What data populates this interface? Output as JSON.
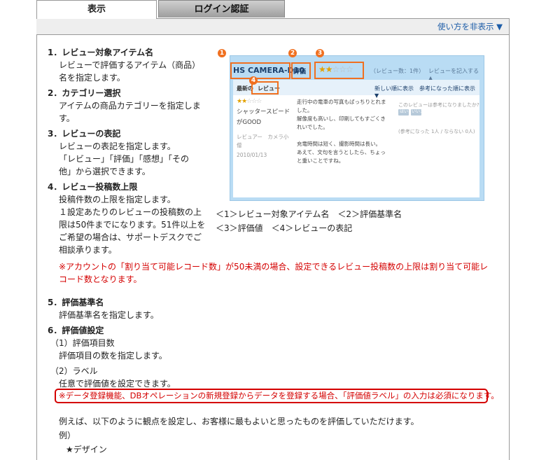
{
  "tabs": [
    {
      "label": "表示"
    },
    {
      "label": "ログイン認証"
    }
  ],
  "howto_toggle": "使い方を非表示 ▼",
  "sections": {
    "s1": {
      "heading": "1．レビュー対象アイテム名",
      "l1": "レビューで評価するアイテム（商品）",
      "l2": "名を指定します。"
    },
    "s2": {
      "heading": "2．カテゴリー選択",
      "l1": "アイテムの商品カテゴリーを指定しま",
      "l2": "す。"
    },
    "s3": {
      "heading": "3．レビューの表記",
      "l1": "レビューの表記を指定します。",
      "l2": "「レビュー」「評価」「感想」「その",
      "l3": "他」から選択できます。"
    },
    "s4": {
      "heading": "4．レビュー投稿数上限",
      "l1": "投稿件数の上限を指定します。",
      "l2": "１設定あたりのレビューの投稿数の上",
      "l3": "限は50件までになります。51件以上を",
      "l4": "ご希望の場合は、サポートデスクでご",
      "l5": "相談承ります。"
    },
    "note_red": "※アカウントの「割り当て可能レコード数」が50未満の場合、設定できるレビュー投稿数の上限は割り当て可能レコード数となります。",
    "s5": {
      "heading": "5．評価基準名",
      "l1": "評価基準名を指定します。"
    },
    "s6": {
      "heading": "6．評価値設定",
      "sub1": "（1）評価項目数",
      "sub1_text": "評価項目の数を指定します。",
      "sub2": "（2）ラベル",
      "sub2_text": "任意で評価値を設定できます。",
      "sub2_warning": "※データ登録機能、DBオペレーションの新規登録からデータを登録する場合、「評価値ラベル」の入力は必須になります。",
      "example_intro": "例えば、以下のように観点を設定し、お客様に最もよいと思ったものを評価していただけます。",
      "example_label": "例）",
      "example_item": "★デザイン"
    }
  },
  "preview": {
    "num1": "1",
    "num2": "2",
    "num3": "3",
    "num4": "4",
    "item_title": "HS CAMERA-D10",
    "eval_label": "評価",
    "stars_top": "★★☆☆☆",
    "review_count": "（レビュー数：1件）",
    "write_review": "レビューを記入する ▲",
    "latest": "最新の",
    "review_word": "レビュー",
    "sort": "新しい順に表示　参考になった順に表示 ▼",
    "stars_small": "★★☆☆☆",
    "review_title1": "シャッタースピード",
    "review_title2": "がGOOD",
    "reviewer1": "レビュアー　カメラ小",
    "reviewer2": "僧",
    "date": "2010/01/13",
    "body1": "走行中の電車の写真もばっちりとれま",
    "body2": "した。",
    "body3": "解像度も高いし、印刷してもすごくき",
    "body4": "れいでした。",
    "body5": "充電時間は短く、撮影時間は長い。",
    "body6": "あえて、文句を言うとしたら、ちょっ",
    "body7": "と重いことですね。",
    "helpful_q": "このレビューは参考になりましたか?",
    "btn_yes": "はい",
    "btn_no": "いいえ",
    "helpful_count": "(参考になった 1人 / ならない 0人)"
  },
  "captions": {
    "line1": "＜1＞レビュー対象アイテム名　＜2＞評価基準名",
    "line2": "＜3＞評価値　＜4＞レビューの表記"
  }
}
